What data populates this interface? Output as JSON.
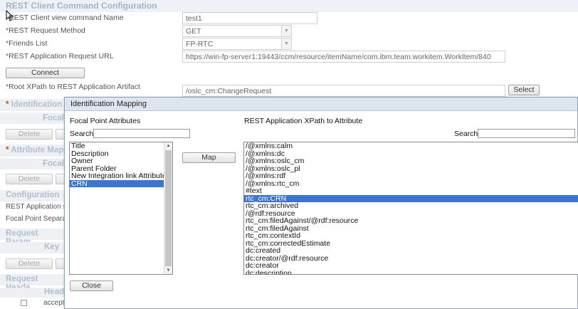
{
  "header": {
    "title": "REST Client Command Configuration"
  },
  "form": {
    "name_label": "REST Client view command Name",
    "name_value": "test1",
    "method_label": "REST Request Method",
    "method_value": "GET",
    "friends_label": "Friends List",
    "friends_value": "FP-RTC",
    "url_label": "REST Application Request URL",
    "url_value": "https://win-fp-server1:19443/ccm/resource/itemName/com.ibm.team.workitem.WorkItem/840",
    "connect_label": "Connect",
    "xpath_label": "Root XPath to REST Application Artifact",
    "xpath_value": "/oslc_cm:ChangeRequest",
    "select_label": "Select",
    "required_mark": "*"
  },
  "background": {
    "identification": "Identification",
    "focal": "Focal",
    "delete1": "Delete",
    "attribute_map": "Attribute Map",
    "focal2": "Focal",
    "delete2": "Delete",
    "configuration": "Configuration",
    "rest_app_s": "REST Application s",
    "focal_point_separat": "Focal Point Separat",
    "request_param": "Request Param",
    "key": "Key",
    "delete3": "Delete",
    "request_header": "Request Heade",
    "header_col": "Heade",
    "accept": "accept"
  },
  "dialog": {
    "title": "Identification Mapping",
    "left_heading": "Focal Point Attributes",
    "left_search_label": "Search",
    "left_items": [
      "Title",
      "Description",
      "Owner",
      "Parent Folder",
      "New Integration link Attribute",
      "CRN"
    ],
    "left_selected_index": 5,
    "map_button": "Map",
    "right_heading": "REST Application XPath to Attribute",
    "right_search_label": "Search",
    "right_items": [
      "/@xmlns:calm",
      "/@xmlns:dc",
      "/@xmlns:oslc_cm",
      "/@xmlns:oslc_pl",
      "/@xmlns:rdf",
      "/@xmlns:rtc_cm",
      "#text",
      "rtc_cm:CRN",
      "rtc_cm:archived",
      "/@rdf:resource",
      "rtc_cm:filedAgainst/@rdf:resource",
      "rtc_cm:filedAgainst",
      "rtc_cm:contextId",
      "rtc_cm:correctedEstimate",
      "dc:created",
      "dc:creator/@rdf:resource",
      "dc:creator",
      "dc:description"
    ],
    "right_selected_index": 7,
    "close_button": "Close"
  },
  "colors": {
    "accent": "#3875d7",
    "section_text": "#a0b4c8",
    "dialog_title_bg": "#dde6ef"
  }
}
